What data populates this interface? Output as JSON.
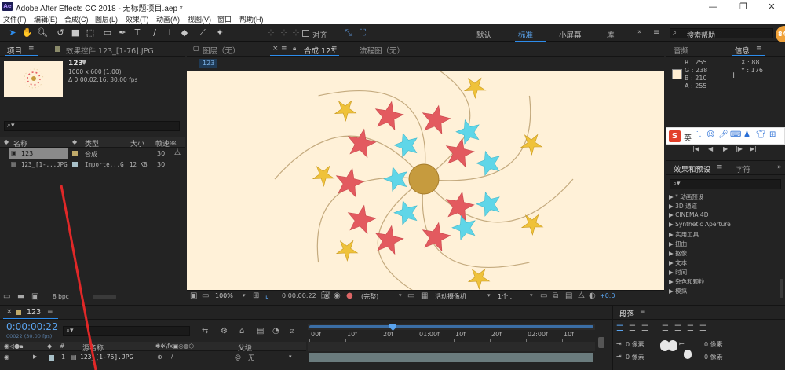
{
  "window": {
    "title": "Adobe After Effects CC 2018 - 无标题项目.aep *",
    "logo": "Ae",
    "minimize": "—",
    "maximize": "❐",
    "close": "✕"
  },
  "menu": [
    "文件(F)",
    "编辑(E)",
    "合成(C)",
    "图层(L)",
    "效果(T)",
    "动画(A)",
    "视图(V)",
    "窗口",
    "帮助(H)"
  ],
  "toolbar": {
    "align_label": "对齐",
    "workspaces": [
      "默认",
      "标准",
      "小屏幕",
      "库"
    ],
    "active_workspace": "标准",
    "search_placeholder": "搜索帮助",
    "badge": "84"
  },
  "project_panel": {
    "tab_project": "项目",
    "tab_effect_controls": "效果控件 123_[1-76].JPG",
    "selected_item": {
      "name": "123",
      "size": "1000 x 600 (1.00)",
      "duration": "Δ 0:00:02:16, 30.00 fps"
    },
    "columns": [
      "名称",
      "类型",
      "大小",
      "帧速率"
    ],
    "items": [
      {
        "name": "123",
        "type": "合成",
        "size": "",
        "fps": "30"
      },
      {
        "name": "123_[1-...JPG",
        "type": "Importe...G",
        "size": "12 KB",
        "fps": "30"
      }
    ],
    "bpc": "8 bpc"
  },
  "viewer": {
    "tab_layer": "图层（无）",
    "tab_comp": "合成 123",
    "tab_flow": "流程图（无）",
    "comp_tag": "123",
    "zoom": "100%",
    "timecode": "0:00:00:22",
    "resolution": "(完整)",
    "camera": "活动摄像机",
    "views": "1个...",
    "exposure": "+0.0"
  },
  "info_panel": {
    "tab_audio": "音频",
    "tab_info": "信息",
    "r": "R : 255",
    "g": "G : 238",
    "b": "B : 210",
    "a": "A : 255",
    "x": "X : 88",
    "y": "Y : 176",
    "swatch": "#ffeed2"
  },
  "ime_bar": {
    "logo": "S",
    "mode": "英"
  },
  "effects_panel": {
    "tab_effects": "效果和预设",
    "tab_char": "字符",
    "items": [
      "* 动画预设",
      "3D 通道",
      "CINEMA 4D",
      "Synthetic Aperture",
      "实用工具",
      "扭曲",
      "抠像",
      "文本",
      "时间",
      "杂色和颗粒",
      "模拟"
    ]
  },
  "timeline": {
    "tab": "123",
    "timecode": "0:00:00:22",
    "fps_note": "00022 (30.00 fps)",
    "ruler": [
      "00f",
      "10f",
      "20f",
      "01:00f",
      "10f",
      "20f",
      "02:00f",
      "10f"
    ],
    "col_source": "源名称",
    "col_parent": "父级",
    "layer": {
      "index": "1",
      "name": "123_[1-76].JPG",
      "parent": "无"
    }
  },
  "paragraph_panel": {
    "tab": "段落",
    "px1": "0 像素",
    "px2": "0 像素",
    "px3": "0 像素",
    "px4": "0 像素"
  },
  "colors": {
    "accent": "#2d8ceb",
    "comp_bg": "#fff1d8",
    "star_red": "#e35a5f",
    "star_cyan": "#5fd6e8",
    "star_yellow": "#efc23a",
    "center": "#c69b3e",
    "curve": "#c4aa7e"
  }
}
